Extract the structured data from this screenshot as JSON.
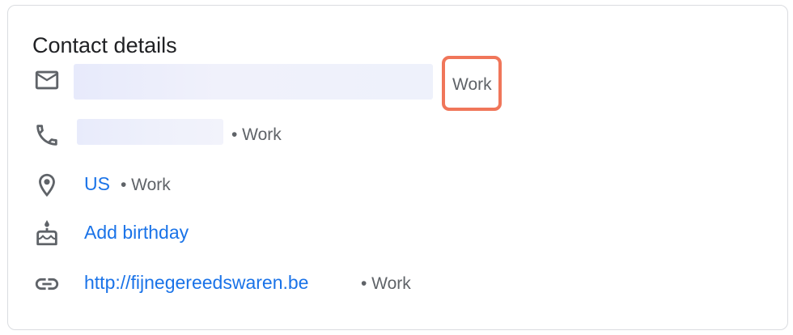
{
  "card": {
    "title": "Contact details"
  },
  "rows": {
    "email": {
      "icon": "mail-icon",
      "label": "Work"
    },
    "phone": {
      "icon": "phone-icon",
      "label": "• Work"
    },
    "address": {
      "icon": "location-pin-icon",
      "value": "US",
      "label": "• Work"
    },
    "birthday": {
      "icon": "cake-icon",
      "value": "Add birthday"
    },
    "website": {
      "icon": "link-icon",
      "value": "http://fijnegereedswaren.be",
      "label": "• Work"
    }
  },
  "colors": {
    "link": "#1a73e8",
    "text_primary": "#202124",
    "text_secondary": "#5f6368",
    "highlight": "#f0765a",
    "redaction": "#eef0fb"
  }
}
